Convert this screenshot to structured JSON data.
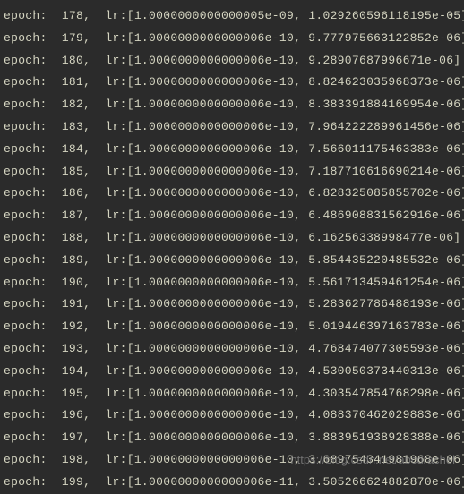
{
  "label_epoch": "epoch:",
  "label_lr": "lr:",
  "watermark": "https://blog.csdn.net/abcdrachel",
  "logs": [
    {
      "epoch": "178",
      "lr1": "1.0000000000000005e-09",
      "lr2": "1.029260596118195e-05"
    },
    {
      "epoch": "179",
      "lr1": "1.0000000000000006e-10",
      "lr2": "9.777975663122852e-06"
    },
    {
      "epoch": "180",
      "lr1": "1.0000000000000006e-10",
      "lr2": "9.28907687996671e-06"
    },
    {
      "epoch": "181",
      "lr1": "1.0000000000000006e-10",
      "lr2": "8.824623035968373e-06"
    },
    {
      "epoch": "182",
      "lr1": "1.0000000000000006e-10",
      "lr2": "8.383391884169954e-06"
    },
    {
      "epoch": "183",
      "lr1": "1.0000000000000006e-10",
      "lr2": "7.964222289961456e-06"
    },
    {
      "epoch": "184",
      "lr1": "1.0000000000000006e-10",
      "lr2": "7.566011175463383e-06"
    },
    {
      "epoch": "185",
      "lr1": "1.0000000000000006e-10",
      "lr2": "7.187710616690214e-06"
    },
    {
      "epoch": "186",
      "lr1": "1.0000000000000006e-10",
      "lr2": "6.828325085855702e-06"
    },
    {
      "epoch": "187",
      "lr1": "1.0000000000000006e-10",
      "lr2": "6.486908831562916e-06"
    },
    {
      "epoch": "188",
      "lr1": "1.0000000000000006e-10",
      "lr2": "6.16256338998477e-06"
    },
    {
      "epoch": "189",
      "lr1": "1.0000000000000006e-10",
      "lr2": "5.854435220485532e-06"
    },
    {
      "epoch": "190",
      "lr1": "1.0000000000000006e-10",
      "lr2": "5.561713459461254e-06"
    },
    {
      "epoch": "191",
      "lr1": "1.0000000000000006e-10",
      "lr2": "5.283627786488193e-06"
    },
    {
      "epoch": "192",
      "lr1": "1.0000000000000006e-10",
      "lr2": "5.019446397163783e-06"
    },
    {
      "epoch": "193",
      "lr1": "1.0000000000000006e-10",
      "lr2": "4.768474077305593e-06"
    },
    {
      "epoch": "194",
      "lr1": "1.0000000000000006e-10",
      "lr2": "4.530050373440313e-06"
    },
    {
      "epoch": "195",
      "lr1": "1.0000000000000006e-10",
      "lr2": "4.303547854768298e-06"
    },
    {
      "epoch": "196",
      "lr1": "1.0000000000000006e-10",
      "lr2": "4.088370462029883e-06"
    },
    {
      "epoch": "197",
      "lr1": "1.0000000000000006e-10",
      "lr2": "3.883951938928388e-06"
    },
    {
      "epoch": "198",
      "lr1": "1.0000000000000006e-10",
      "lr2": "3.689754341981968e-06"
    },
    {
      "epoch": "199",
      "lr1": "1.0000000000000006e-11",
      "lr2": "3.505266624882870e-06"
    }
  ]
}
